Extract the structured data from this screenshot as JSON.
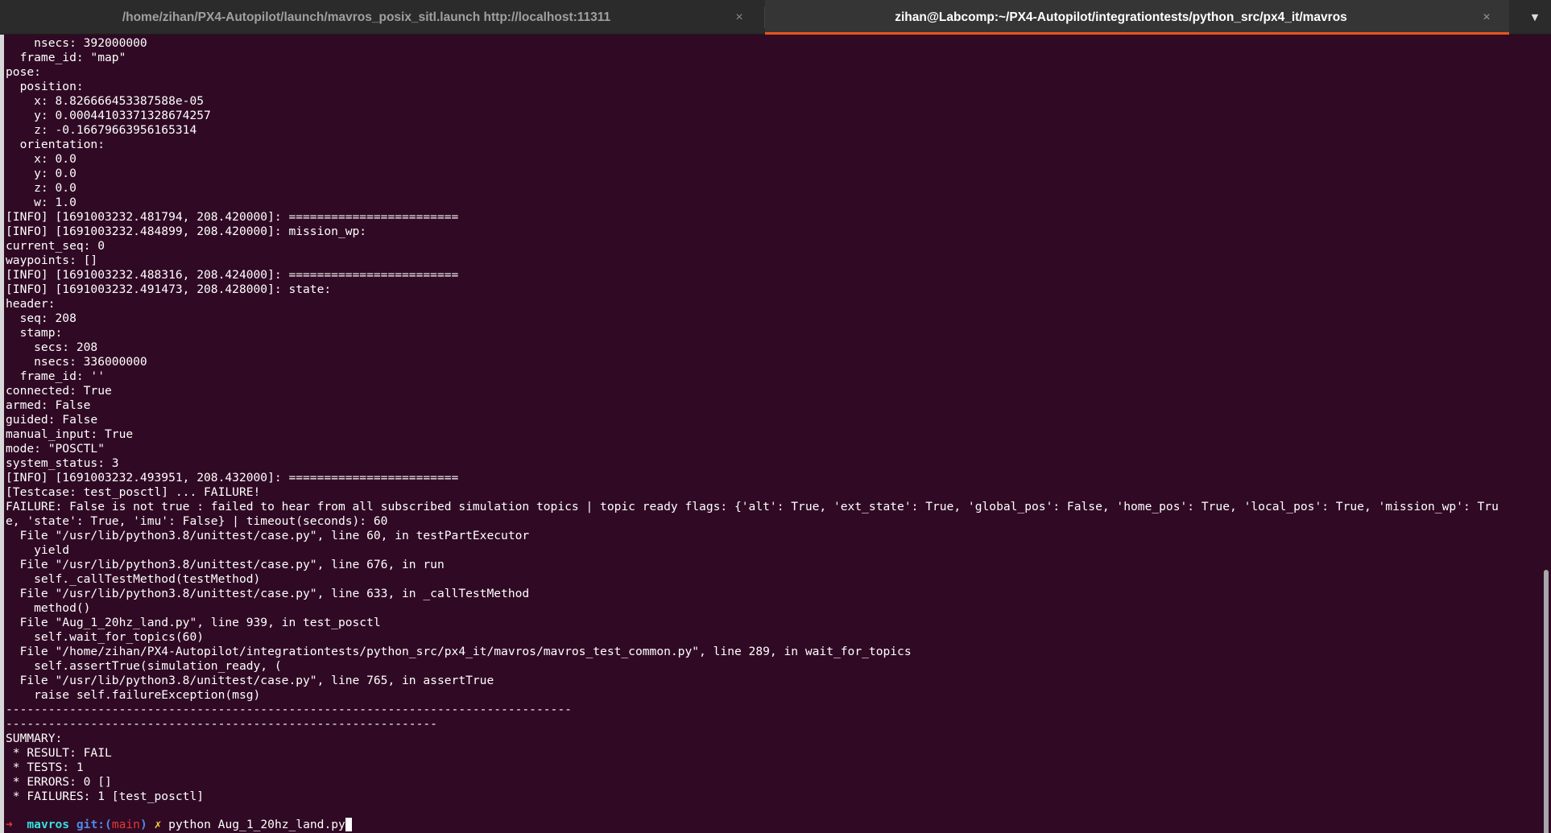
{
  "tabs": [
    {
      "title": "/home/zihan/PX4-Autopilot/launch/mavros_posix_sitl.launch http://localhost:11311",
      "close": "×",
      "active": false
    },
    {
      "title": "zihan@Labcomp:~/PX4-Autopilot/integrationtests/python_src/px4_it/mavros",
      "close": "×",
      "active": true
    }
  ],
  "tab_menu_icon": "▼",
  "colors": {
    "background": "#300a24",
    "tab_bar": "#2b2b2b",
    "active_tab_underline": "#e95420",
    "prompt_arrow": "#e53935",
    "prompt_dir": "#34e2e2",
    "prompt_git": "#4f8ae8",
    "prompt_dirty": "#f2d43a"
  },
  "terminal_lines": [
    "    nsecs: 392000000",
    "  frame_id: \"map\"",
    "pose:",
    "  position:",
    "    x: 8.826666453387588e-05",
    "    y: 0.00044103371328674257",
    "    z: -0.16679663956165314",
    "  orientation:",
    "    x: 0.0",
    "    y: 0.0",
    "    z: 0.0",
    "    w: 1.0",
    "[INFO] [1691003232.481794, 208.420000]: ========================",
    "[INFO] [1691003232.484899, 208.420000]: mission_wp:",
    "current_seq: 0",
    "waypoints: []",
    "[INFO] [1691003232.488316, 208.424000]: ========================",
    "[INFO] [1691003232.491473, 208.428000]: state:",
    "header:",
    "  seq: 208",
    "  stamp:",
    "    secs: 208",
    "    nsecs: 336000000",
    "  frame_id: ''",
    "connected: True",
    "armed: False",
    "guided: False",
    "manual_input: True",
    "mode: \"POSCTL\"",
    "system_status: 3",
    "[INFO] [1691003232.493951, 208.432000]: ========================",
    "[Testcase: test_posctl] ... FAILURE!",
    "FAILURE: False is not true : failed to hear from all subscribed simulation topics | topic ready flags: {'alt': True, 'ext_state': True, 'global_pos': False, 'home_pos': True, 'local_pos': True, 'mission_wp': Tru",
    "e, 'state': True, 'imu': False} | timeout(seconds): 60",
    "  File \"/usr/lib/python3.8/unittest/case.py\", line 60, in testPartExecutor",
    "    yield",
    "  File \"/usr/lib/python3.8/unittest/case.py\", line 676, in run",
    "    self._callTestMethod(testMethod)",
    "  File \"/usr/lib/python3.8/unittest/case.py\", line 633, in _callTestMethod",
    "    method()",
    "  File \"Aug_1_20hz_land.py\", line 939, in test_posctl",
    "    self.wait_for_topics(60)",
    "  File \"/home/zihan/PX4-Autopilot/integrationtests/python_src/px4_it/mavros/mavros_test_common.py\", line 289, in wait_for_topics",
    "    self.assertTrue(simulation_ready, (",
    "  File \"/usr/lib/python3.8/unittest/case.py\", line 765, in assertTrue",
    "    raise self.failureException(msg)",
    "--------------------------------------------------------------------------------",
    "-------------------------------------------------------------",
    "SUMMARY:",
    " * RESULT: FAIL",
    " * TESTS: 1",
    " * ERRORS: 0 []",
    " * FAILURES: 1 [test_posctl]",
    ""
  ],
  "prompt": {
    "arrow": "➜",
    "dir": "mavros",
    "git_label": "git:(",
    "branch": "main",
    "git_close": ")",
    "dirty": "✗",
    "command": "python Aug_1_20hz_land.py"
  }
}
